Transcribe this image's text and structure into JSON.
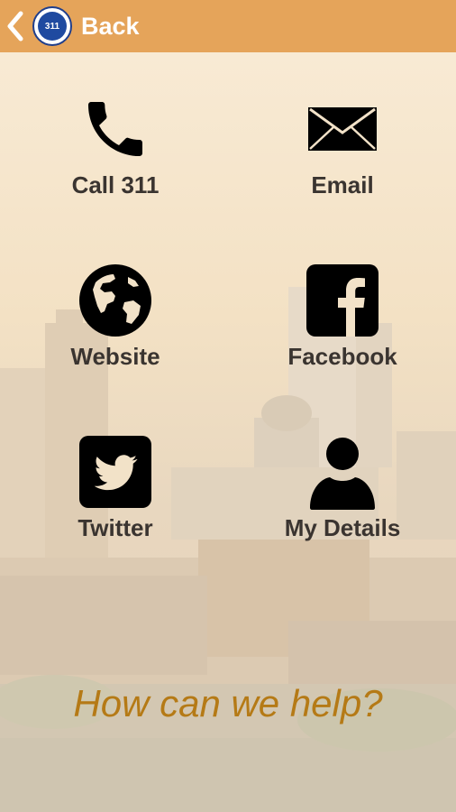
{
  "header": {
    "back_label": "Back",
    "logo_text": "311",
    "background": "#e5a45a"
  },
  "tiles": [
    {
      "label": "Call 311",
      "icon": "phone-icon"
    },
    {
      "label": "Email",
      "icon": "envelope-icon"
    },
    {
      "label": "Website",
      "icon": "globe-icon"
    },
    {
      "label": "Facebook",
      "icon": "facebook-icon"
    },
    {
      "label": "Twitter",
      "icon": "twitter-icon"
    },
    {
      "label": "My Details",
      "icon": "person-icon"
    }
  ],
  "tagline": "How can we help?",
  "colors": {
    "accent": "#e5a45a",
    "tagline": "#b57a16",
    "label": "#3a3430"
  }
}
